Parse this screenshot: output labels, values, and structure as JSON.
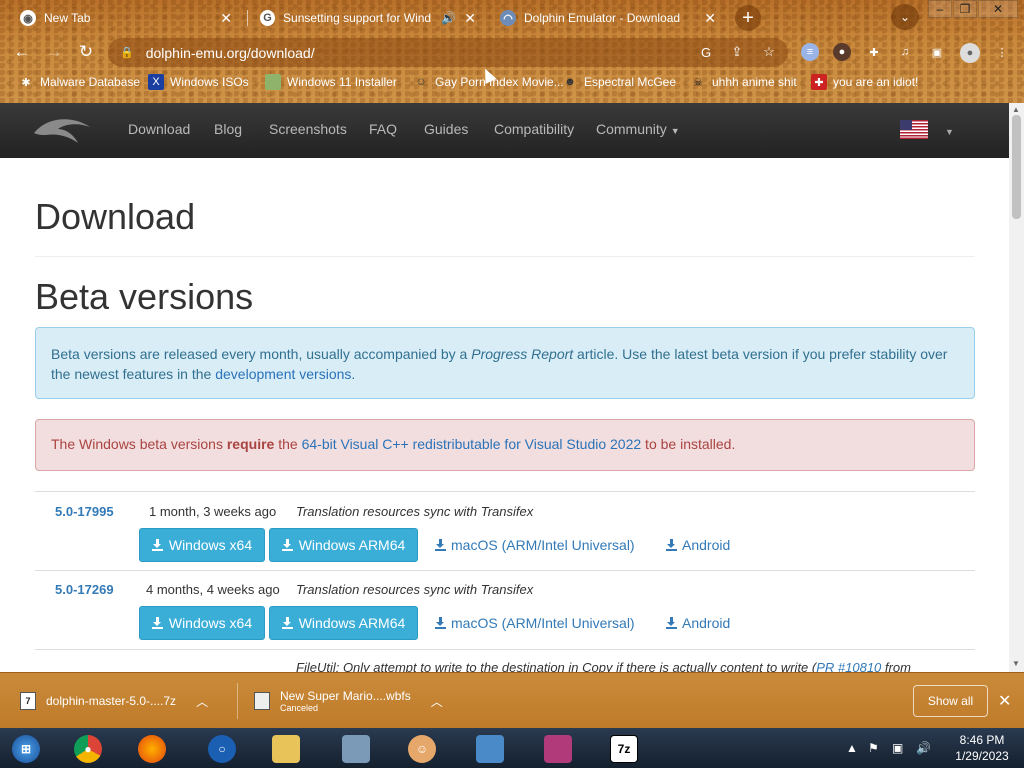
{
  "browser": {
    "tabs": [
      {
        "title": "New Tab",
        "icon": "chrome-icon"
      },
      {
        "title": "Sunsetting support for Wind",
        "icon": "google-icon"
      },
      {
        "title": "Dolphin Emulator - Download",
        "icon": "dolphin-icon"
      }
    ],
    "url": "dolphin-emu.org/download/",
    "bookmarks": [
      {
        "label": "Malware Database"
      },
      {
        "label": "Windows ISOs"
      },
      {
        "label": "Windows 11 Installer"
      },
      {
        "label": "Gay Porn Index Movie..."
      },
      {
        "label": "Espectral McGee"
      },
      {
        "label": "uhhh anime shit"
      },
      {
        "label": "you are an idiot!"
      }
    ]
  },
  "site": {
    "nav": [
      "Download",
      "Blog",
      "Screenshots",
      "FAQ",
      "Guides",
      "Compatibility",
      "Community"
    ],
    "page_title": "Download",
    "section_title": "Beta versions",
    "info": {
      "text1": "Beta versions are released every month, usually accompanied by a ",
      "em": "Progress Report",
      "text2": " article. Use the latest beta version if you prefer stability over the newest features in the ",
      "link": "development versions",
      "text3": "."
    },
    "warning": {
      "text1": "The Windows beta versions ",
      "bold": "require",
      "text2": " the ",
      "link": "64-bit Visual C++ redistributable for Visual Studio 2022",
      "text3": " to be installed."
    },
    "releases": [
      {
        "version": "5.0-17995",
        "date": "1 month, 3 weeks ago",
        "commit": "Translation resources sync with Transifex"
      },
      {
        "version": "5.0-17269",
        "date": "4 months, 4 weeks ago",
        "commit": "Translation resources sync with Transifex"
      }
    ],
    "buttons": {
      "win": "Windows x64",
      "arm": "Windows ARM64",
      "mac": "macOS (ARM/Intel Universal)",
      "android": "Android"
    },
    "next_commit": {
      "text": "FileUtil: Only attempt to write to the destination in Copy if there is actually content to write (",
      "link": "PR #10810",
      "tail": " from"
    }
  },
  "downloads": [
    {
      "name": "dolphin-master-5.0-....7z",
      "status": ""
    },
    {
      "name": "New Super Mario....wbfs",
      "status": "Canceled"
    }
  ],
  "show_all": "Show all",
  "clock": {
    "time": "8:46 PM",
    "date": "1/29/2023"
  }
}
